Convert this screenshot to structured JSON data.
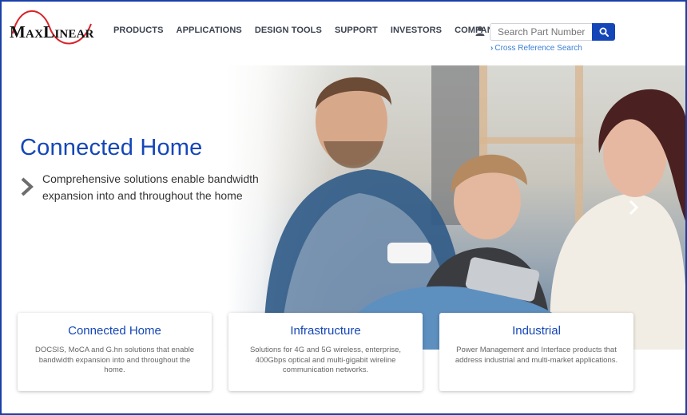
{
  "header": {
    "logo": "MaxLinear",
    "nav": [
      "PRODUCTS",
      "APPLICATIONS",
      "DESIGN TOOLS",
      "SUPPORT",
      "INVESTORS",
      "COMPANY"
    ],
    "search": {
      "placeholder": "Search Part Number",
      "value": ""
    },
    "cross_reference": "Cross Reference Search"
  },
  "hero": {
    "title": "Connected Home",
    "subtitle": "Comprehensive solutions enable bandwidth expansion into and throughout the home"
  },
  "cards": [
    {
      "title": "Connected Home",
      "description": "DOCSIS, MoCA and G.hn solutions that enable bandwidth expansion into and throughout the home."
    },
    {
      "title": "Infrastructure",
      "description": "Solutions for 4G and 5G wireless, enterprise, 400Gbps optical and multi-gigabit wireline communication networks."
    },
    {
      "title": "Industrial",
      "description": "Power Management and Interface products that address industrial and multi-market applications."
    }
  ],
  "colors": {
    "brand_blue": "#1446b8",
    "link_blue": "#3a7fd6",
    "logo_red": "#d8232a"
  }
}
